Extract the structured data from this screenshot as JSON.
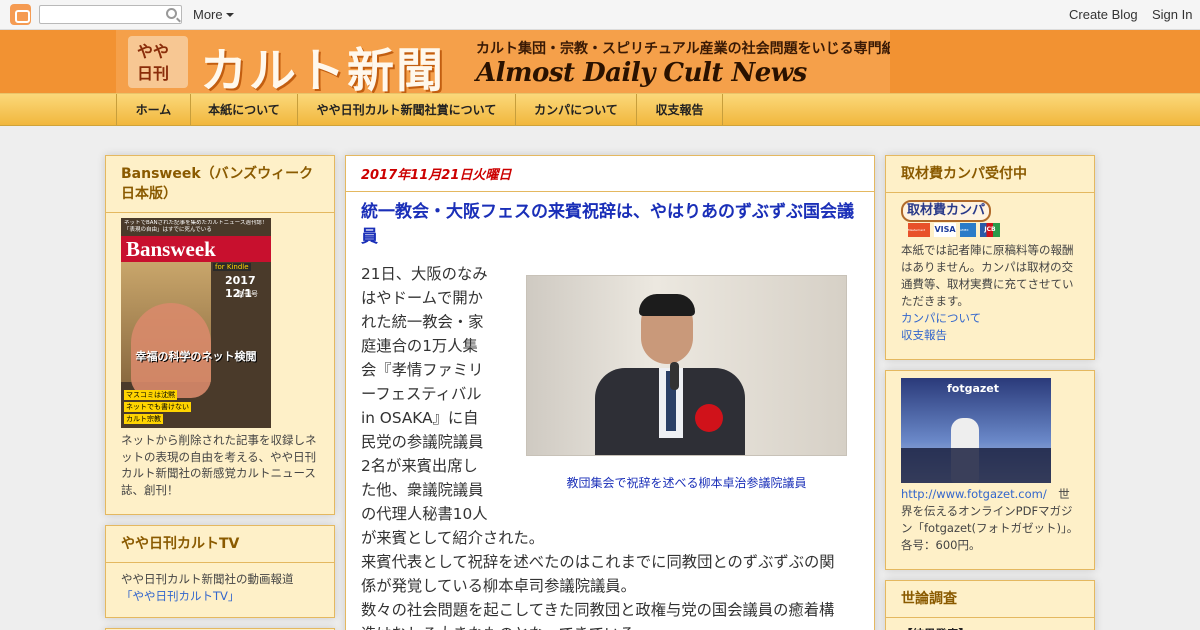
{
  "navbar": {
    "more_label": "More",
    "create_blog": "Create Blog",
    "sign_in": "Sign In",
    "search_placeholder": ""
  },
  "header": {
    "logo_line1": "やや",
    "logo_line2": "日刊",
    "title": "カルト新聞",
    "tagline": "カルト集団・宗教・スピリチュアル産業の社会問題をいじる専門紙",
    "english_title": "Almost Daily Cult News"
  },
  "tabs": [
    "ホーム",
    "本紙について",
    "やや日刊カルト新聞社賞について",
    "カンパについて",
    "収支報告"
  ],
  "left": {
    "bansweek": {
      "title": "Bansweek（バンズウィーク日本版）",
      "cover_top": "ネットでBANされた記事を集めたカルトニュース週刊誌！「表現の自由」はすでに死んでいる",
      "cover_mast": "Bansweek",
      "cover_kindle": "for Kindle",
      "cover_date": "2017 12/1",
      "cover_issue": "創刊号",
      "cover_headline": "幸福の科学のネット検閲",
      "cover_side1": "マスコミは沈黙",
      "cover_side2": "ネットでも書けない",
      "cover_side3": "カルト宗教",
      "body": "ネットから削除された記事を収録しネットの表現の自由を考える、やや日刊カルト新聞社の新感覚カルトニュース誌、創刊！"
    },
    "tv": {
      "title": "やや日刊カルトTV",
      "body": "やや日刊カルト新聞社の動画報道",
      "link": "「やや日刊カルトTV」"
    }
  },
  "post": {
    "date": "2017年11月21日火曜日",
    "title": "統一教会・大阪フェスの来賓祝辞は、やはりあのずぶずぶ国会議員",
    "caption": "教団集会で祝辞を述べる柳本卓治参議院議員",
    "lines": [
      "21日、大阪のなみ",
      "はやドームで開か",
      "れた統一教会・家",
      "庭連合の1万人集",
      "会『孝情ファミリ",
      "ーフェスティバル",
      "in OSAKA』に自",
      "民党の参議院議員",
      "2名が来賓出席し",
      "た他、衆議院議員",
      "の代理人秘書10人",
      "が来賓として紹介された。",
      "来賓代表として祝辞を述べたのはこれまでに同教団とのずぶずぶの関",
      "係が発覚している柳本卓司参議院議員。",
      "数々の社会問題を起こしてきた同教団と政権与党の国会議員の癒着構",
      "造はむしろ大きなものとなってきている。"
    ]
  },
  "right": {
    "campa": {
      "title": "取材費カンパ受付中",
      "badge": "取材費カンパ",
      "card1": "MasterCard",
      "card2": "VISA",
      "card3": "AMEX",
      "card4": "JCB",
      "body": "本紙では記者陣に原稿料等の報酬はありません。カンパは取材の交通費等、取材実費に充てさせていただきます。",
      "link1": "カンパについて",
      "link2": "収支報告"
    },
    "fotgazet": {
      "logo": "fotgazet",
      "url": "http://www.fotgazet.com/",
      "body_after_url": "　世界を伝えるオンラインPDFマガジン「fotgazet(フォトガゼット)」。各号：600円。"
    },
    "poll": {
      "title": "世論調査",
      "first_line": "【結果発表】"
    }
  }
}
